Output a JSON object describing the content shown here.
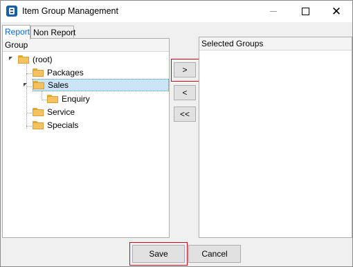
{
  "window": {
    "title": "Item Group Management"
  },
  "tabs": [
    {
      "label": "Report"
    },
    {
      "label": "Non Report"
    }
  ],
  "left_panel": {
    "header": "Group",
    "tree": [
      {
        "label": "(root)"
      },
      {
        "label": "Packages"
      },
      {
        "label": "Sales"
      },
      {
        "label": "Enquiry"
      },
      {
        "label": "Service"
      },
      {
        "label": "Specials"
      }
    ],
    "selected": "Sales"
  },
  "right_panel": {
    "header": "Selected Groups"
  },
  "transfer_buttons": {
    "add": ">",
    "remove": "<",
    "remove_all": "<<"
  },
  "footer": {
    "save": "Save",
    "cancel": "Cancel"
  },
  "colors": {
    "highlight": "#d0021b",
    "selection": "#cce4f7",
    "active_tab_text": "#0066cc",
    "folder": "#f5c260"
  }
}
